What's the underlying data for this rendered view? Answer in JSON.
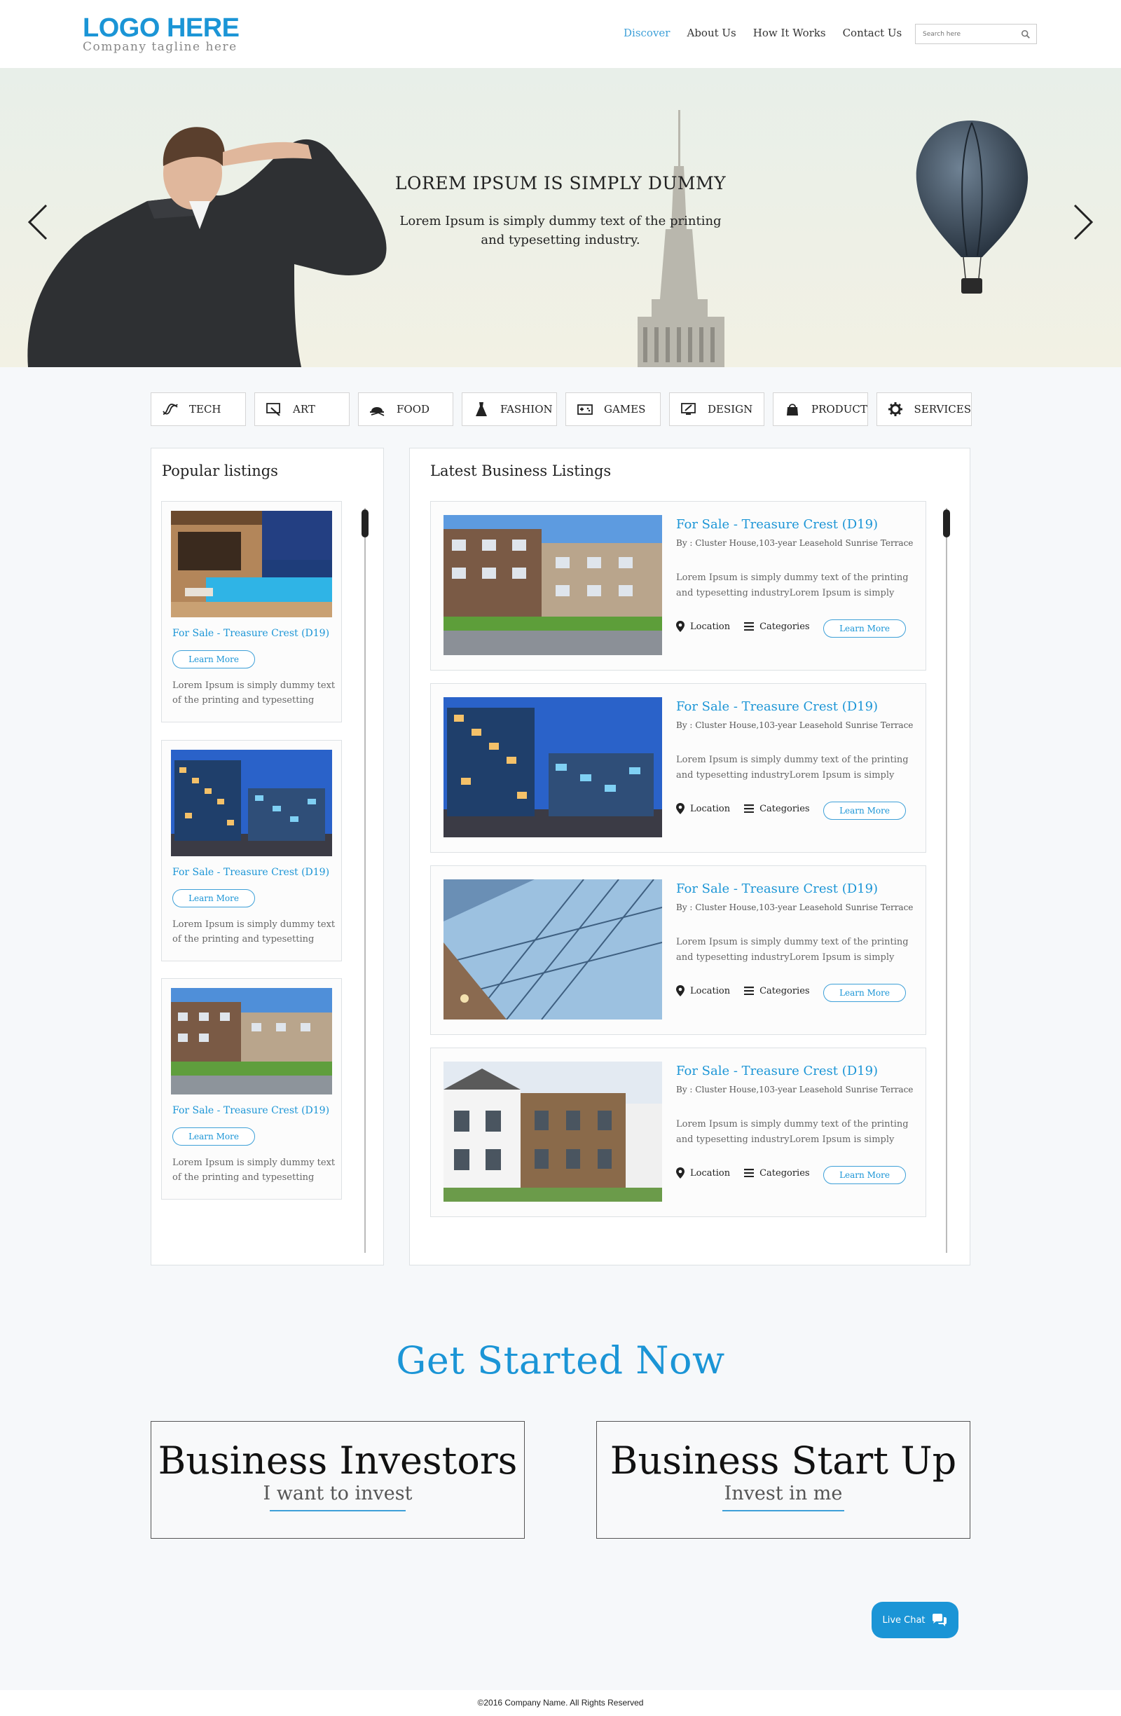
{
  "header": {
    "logo": "LOGO HERE",
    "tagline": "Company tagline here",
    "nav": [
      "Discover",
      "About Us",
      "How It Works",
      "Contact Us"
    ],
    "search_placeholder": "Search here"
  },
  "hero": {
    "title": "LOREM IPSUM IS SIMPLY DUMMY",
    "subtitle": "Lorem Ipsum is simply dummy text of the printing and typesetting industry."
  },
  "categories": [
    {
      "label": "TECH",
      "icon": "dna-icon"
    },
    {
      "label": "ART",
      "icon": "canvas-icon"
    },
    {
      "label": "FOOD",
      "icon": "cloche-icon"
    },
    {
      "label": "FASHION",
      "icon": "dress-icon"
    },
    {
      "label": "GAMES",
      "icon": "gamepad-icon"
    },
    {
      "label": "DESIGN",
      "icon": "monitor-pen-icon"
    },
    {
      "label": "PRODUCT",
      "icon": "bag-icon"
    },
    {
      "label": "SERVICES",
      "icon": "gear-icon"
    }
  ],
  "popular": {
    "title": "Popular listings",
    "items": [
      {
        "title": "For Sale - Treasure Crest (D19)",
        "button": "Learn More",
        "desc": "Lorem Ipsum is simply dummy text of the printing and typesetting"
      },
      {
        "title": "For Sale - Treasure Crest (D19)",
        "button": "Learn More",
        "desc": "Lorem Ipsum is simply dummy text of the printing and typesetting"
      },
      {
        "title": "For Sale - Treasure Crest (D19)",
        "button": "Learn More",
        "desc": "Lorem Ipsum is simply dummy text of the printing and typesetting"
      }
    ]
  },
  "latest": {
    "title": "Latest Business Listings",
    "items": [
      {
        "title": "For Sale - Treasure Crest (D19)",
        "by": "By : Cluster House,103-year Leasehold Sunrise Terrace",
        "desc": "Lorem Ipsum is simply dummy text of the printing and typesetting industryLorem Ipsum is simply",
        "location": "Location",
        "categories": "Categories",
        "button": "Learn More"
      },
      {
        "title": "For Sale - Treasure Crest (D19)",
        "by": "By : Cluster House,103-year Leasehold Sunrise Terrace",
        "desc": "Lorem Ipsum is simply dummy text of the printing and typesetting industryLorem Ipsum is simply",
        "location": "Location",
        "categories": "Categories",
        "button": "Learn More"
      },
      {
        "title": "For Sale - Treasure Crest (D19)",
        "by": "By : Cluster House,103-year Leasehold Sunrise Terrace",
        "desc": "Lorem Ipsum is simply dummy text of the printing and typesetting industryLorem Ipsum is simply",
        "location": "Location",
        "categories": "Categories",
        "button": "Learn More"
      },
      {
        "title": "For Sale - Treasure Crest (D19)",
        "by": "By : Cluster House,103-year Leasehold Sunrise Terrace",
        "desc": "Lorem Ipsum is simply dummy text of the printing and typesetting industryLorem Ipsum is simply",
        "location": "Location",
        "categories": "Categories",
        "button": "Learn More"
      }
    ]
  },
  "get_started": {
    "title": "Get Started Now",
    "boxes": [
      {
        "heading": "Business Investors",
        "sub": "I want to invest"
      },
      {
        "heading": "Business Start Up",
        "sub": "Invest in me"
      }
    ]
  },
  "chat": {
    "label": "Live Chat"
  },
  "footer": {
    "copyright": "©2016 Company Name. All Rights Reserved"
  },
  "colors": {
    "accent": "#1b95d6",
    "text": "#222222",
    "background": "#f6f8fa"
  }
}
